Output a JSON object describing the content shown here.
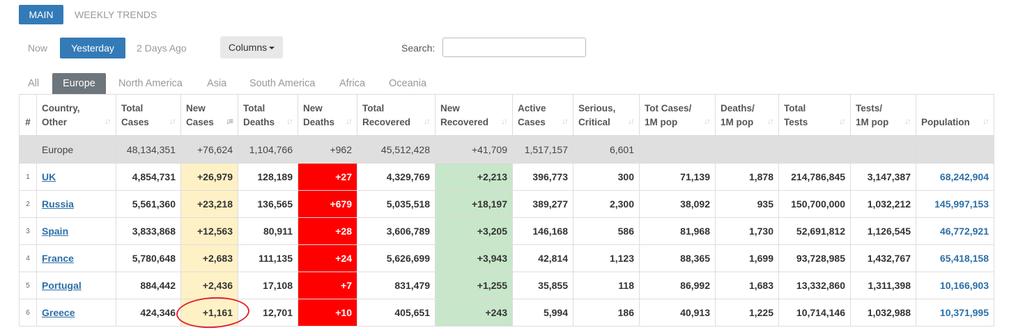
{
  "top_tabs": [
    "MAIN",
    "WEEKLY TRENDS"
  ],
  "day_tabs": [
    "Now",
    "Yesterday",
    "2 Days Ago"
  ],
  "columns_label": "Columns",
  "search_label": "Search:",
  "search_value": "",
  "region_tabs": [
    "All",
    "Europe",
    "North America",
    "Asia",
    "South America",
    "Africa",
    "Oceania"
  ],
  "table": {
    "headers": [
      {
        "l1": "#",
        "l2": ""
      },
      {
        "l1": "Country,",
        "l2": "Other"
      },
      {
        "l1": "Total",
        "l2": "Cases"
      },
      {
        "l1": "New",
        "l2": "Cases"
      },
      {
        "l1": "Total",
        "l2": "Deaths"
      },
      {
        "l1": "New",
        "l2": "Deaths"
      },
      {
        "l1": "Total",
        "l2": "Recovered"
      },
      {
        "l1": "New",
        "l2": "Recovered"
      },
      {
        "l1": "Active",
        "l2": "Cases"
      },
      {
        "l1": "Serious,",
        "l2": "Critical"
      },
      {
        "l1": "Tot Cases/",
        "l2": "1M pop"
      },
      {
        "l1": "Deaths/",
        "l2": "1M pop"
      },
      {
        "l1": "Total",
        "l2": "Tests"
      },
      {
        "l1": "Tests/",
        "l2": "1M pop"
      },
      {
        "l1": "",
        "l2": "Population"
      }
    ],
    "total_row": [
      "",
      "Europe",
      "48,134,351",
      "+76,624",
      "1,104,766",
      "+962",
      "45,512,428",
      "+41,709",
      "1,517,157",
      "6,601",
      "",
      "",
      "",
      "",
      ""
    ],
    "rows": [
      [
        "1",
        "UK",
        "4,854,731",
        "+26,979",
        "128,189",
        "+27",
        "4,329,769",
        "+2,213",
        "396,773",
        "300",
        "71,139",
        "1,878",
        "214,786,845",
        "3,147,387",
        "68,242,904"
      ],
      [
        "2",
        "Russia",
        "5,561,360",
        "+23,218",
        "136,565",
        "+679",
        "5,035,518",
        "+18,197",
        "389,277",
        "2,300",
        "38,092",
        "935",
        "150,700,000",
        "1,032,212",
        "145,997,153"
      ],
      [
        "3",
        "Spain",
        "3,833,868",
        "+12,563",
        "80,911",
        "+28",
        "3,606,789",
        "+3,205",
        "146,168",
        "586",
        "81,968",
        "1,730",
        "52,691,812",
        "1,126,545",
        "46,772,921"
      ],
      [
        "4",
        "France",
        "5,780,648",
        "+2,683",
        "111,135",
        "+24",
        "5,626,699",
        "+3,943",
        "42,814",
        "1,123",
        "88,365",
        "1,699",
        "93,728,985",
        "1,432,767",
        "65,418,158"
      ],
      [
        "5",
        "Portugal",
        "884,442",
        "+2,436",
        "17,108",
        "+7",
        "831,479",
        "+1,255",
        "35,855",
        "118",
        "86,992",
        "1,683",
        "13,332,860",
        "1,311,398",
        "10,166,903"
      ],
      [
        "6",
        "Greece",
        "424,346",
        "+1,161",
        "12,701",
        "+10",
        "405,651",
        "+243",
        "5,994",
        "186",
        "40,913",
        "1,225",
        "10,714,146",
        "1,032,988",
        "10,371,995"
      ]
    ]
  },
  "colors": {
    "accent": "#337ab7",
    "new_cases_bg": "#fff1c6",
    "new_deaths_bg": "#ff0000",
    "new_recovered_bg": "#c8e6c9",
    "link": "#2b6fa8",
    "annotation": "#e0262d"
  }
}
